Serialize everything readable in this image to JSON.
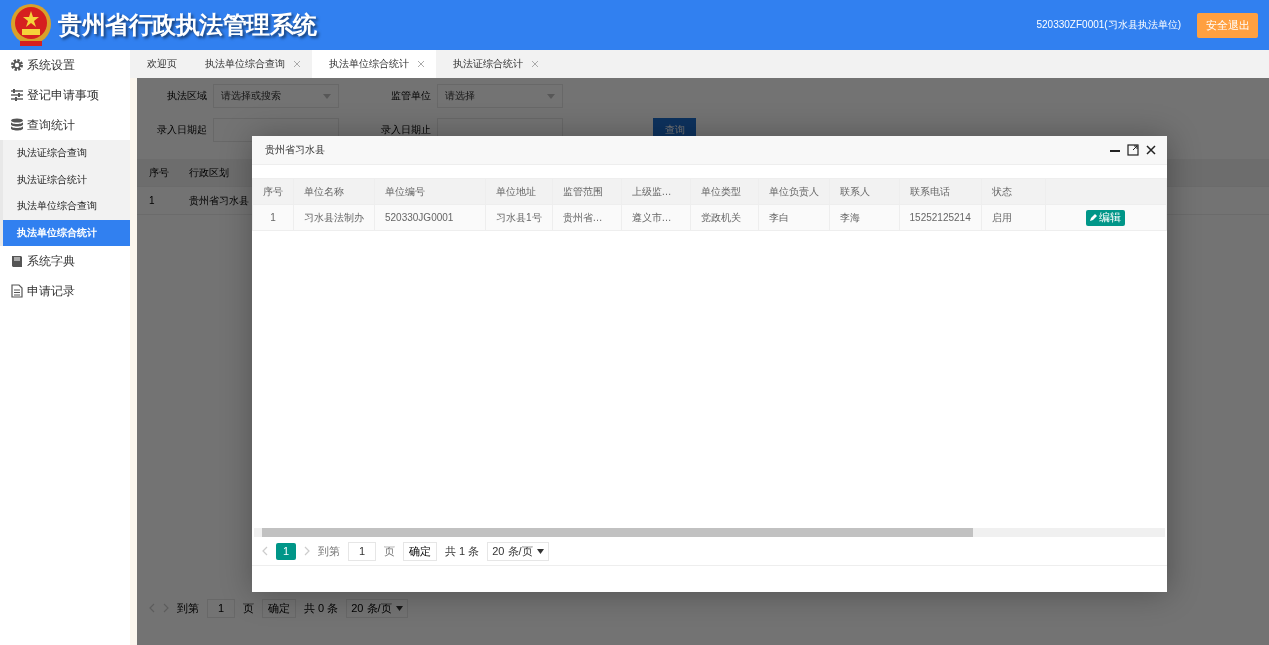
{
  "header": {
    "title": "贵州省行政执法管理系统",
    "user": "520330ZF0001(习水县执法单位)",
    "logout_button": "安全退出"
  },
  "sidebar": {
    "items": [
      {
        "label": "系统设置",
        "kind": "gear",
        "selected": false
      },
      {
        "label": "登记申请事项",
        "kind": "sliders",
        "selected": false
      },
      {
        "label": "查询统计",
        "kind": "database",
        "selected": false,
        "expanded": true,
        "children": [
          {
            "label": "执法证综合查询",
            "selected": false
          },
          {
            "label": "执法证综合统计",
            "selected": false
          },
          {
            "label": "执法单位综合查询",
            "selected": false
          },
          {
            "label": "执法单位综合统计",
            "selected": true
          }
        ]
      },
      {
        "label": "系统字典",
        "kind": "book",
        "selected": false
      },
      {
        "label": "申请记录",
        "kind": "document",
        "selected": false
      }
    ]
  },
  "tabs": [
    {
      "label": "欢迎页",
      "closable": false,
      "selected": false
    },
    {
      "label": "执法单位综合查询",
      "closable": true,
      "selected": false
    },
    {
      "label": "执法单位综合统计",
      "closable": true,
      "selected": true
    },
    {
      "label": "执法证综合统计",
      "closable": true,
      "selected": false
    }
  ],
  "filters": {
    "region_label": "执法区域",
    "region_placeholder": "请选择或搜索",
    "unit_label": "监管单位",
    "unit_placeholder": "请选择",
    "date_from_label": "录入日期起",
    "date_to_label": "录入日期止",
    "query_button": "查询"
  },
  "background_table": {
    "columns": [
      "序号",
      "行政区划"
    ],
    "rows": [
      [
        "1",
        "贵州省习水县"
      ]
    ]
  },
  "background_pagination": {
    "goto_label": "到第",
    "page_value": "1",
    "page_unit": "页",
    "confirm": "确定",
    "total": "共 0 条",
    "page_size": "20 条/页"
  },
  "modal": {
    "title": "贵州省习水县",
    "table": {
      "columns": [
        "序号",
        "单位名称",
        "单位编号",
        "单位地址",
        "监管范围",
        "上级监…",
        "单位类型",
        "单位负责人",
        "联系人",
        "联系电话",
        "状态"
      ],
      "rows": [
        {
          "cells": [
            "1",
            "习水县法制办",
            "520330JG0001",
            "习水县1号",
            "贵州省…",
            "遵义市…",
            "党政机关",
            "李白",
            "李海",
            "15252125214",
            "启用"
          ],
          "action": "编辑"
        }
      ]
    },
    "pagination": {
      "pages": [
        {
          "label": "1",
          "selected": true
        }
      ],
      "goto_label": "到第",
      "page_value": "1",
      "page_unit": "页",
      "confirm": "确定",
      "total": "共 1 条",
      "page_size": "20 条/页"
    }
  }
}
